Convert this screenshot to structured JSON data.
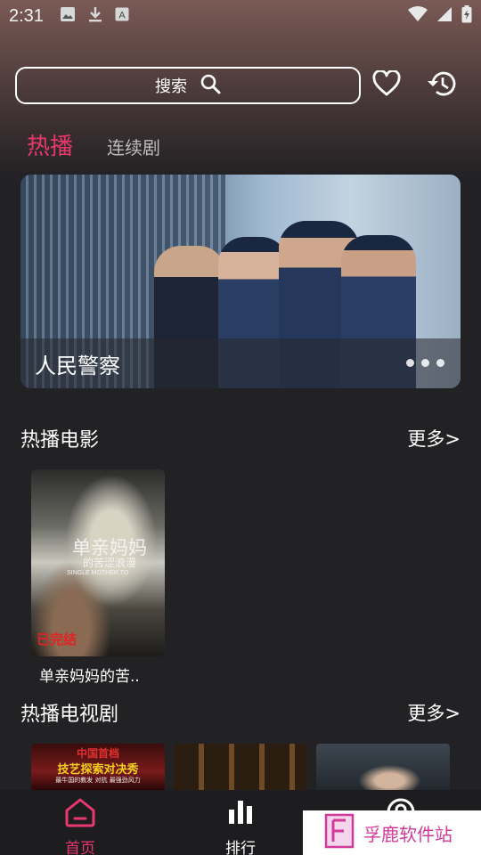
{
  "status_bar": {
    "time": "2:31",
    "left_icons": [
      "image-icon",
      "download-icon",
      "a-icon"
    ],
    "right_icons": [
      "wifi-icon",
      "signal-icon",
      "battery-icon"
    ]
  },
  "search": {
    "label": "搜索"
  },
  "header_icons": [
    "heart-icon",
    "history-icon"
  ],
  "tabs": [
    {
      "label": "热播",
      "active": true
    },
    {
      "label": "连续剧",
      "active": false
    }
  ],
  "banner": {
    "title": "人民警察",
    "dots": 3
  },
  "sections": {
    "movies": {
      "title": "热播电影",
      "more": "更多>",
      "items": [
        {
          "title": "单亲妈妈的苦..",
          "poster_text": "单亲妈妈",
          "poster_sub": "的苦涩浪漫",
          "poster_en": "SINGLE MOTHER TO",
          "badge": "已完结"
        }
      ]
    },
    "tv": {
      "title": "热播电视剧",
      "more": "更多>",
      "items": [
        {
          "line1": "中国首档",
          "line2": "技艺探索对决秀",
          "line3": "最牛国的教发  对抗  最强劲风力"
        },
        {
          "line1": ""
        },
        {
          "line1": ""
        }
      ]
    }
  },
  "bottom_nav": [
    {
      "label": "首页",
      "icon": "home-icon",
      "active": true
    },
    {
      "label": "排行",
      "icon": "bar-chart-icon",
      "active": false
    },
    {
      "label": "",
      "icon": "profile-icon",
      "active": false
    }
  ],
  "watermark": {
    "text": "孚鹿软件站"
  },
  "colors": {
    "accent": "#e8386d",
    "background": "#222123"
  }
}
